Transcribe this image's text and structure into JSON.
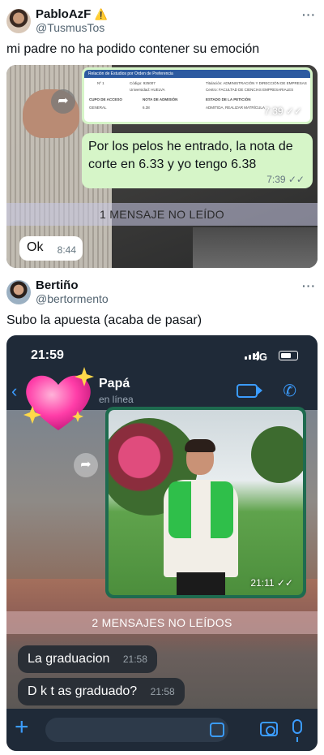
{
  "tweet1": {
    "display_name": "PabloAzF",
    "badge_emoji": "⚠️",
    "handle": "@TusmusTos",
    "text": "mi padre no ha podido contener su emoción"
  },
  "screenshot1": {
    "document": {
      "header": "Relación de Estudios por Orden de Preferencia",
      "order_label": "Nº 1",
      "code": "Código: 925007",
      "university": "Universidad: HUELVA",
      "degree": "Titulación: ADMINISTRACIÓN Y DIRECCIÓN DE EMPRESAS",
      "center": "Centro: FACULTAD DE CIENCIAS EMPRESARIALES",
      "access_quota_label": "CUPO DE ACCESO",
      "admission_grade_label": "NOTA DE ADMISIÓN",
      "request_state_label": "ESTADO DE LA PETICIÓN",
      "access_quota": "GENERAL",
      "admission_grade": "6.38",
      "request_state": "ADMITIDA, REALIZAR MATRÍCULA",
      "time": "7:39 ✓✓"
    },
    "message": {
      "text": "Por los pelos he entrado, la nota de corte en 6.33 y yo tengo 6.38",
      "time": "7:39 ✓✓"
    },
    "unread_banner": "1 MENSAJE NO LEÍDO",
    "reply": {
      "text": "Ok",
      "time": "8:44"
    }
  },
  "tweet2": {
    "display_name": "Bertiño",
    "handle": "@bertormento",
    "text": "Subo la apuesta (acaba de pasar)"
  },
  "screenshot2": {
    "status": {
      "time": "21:59",
      "network": "4G"
    },
    "chat": {
      "contact_name": "Papá",
      "contact_status": "en línea",
      "photo_time": "21:11 ✓✓",
      "unread_banner": "2 MENSAJES NO LEÍDOS",
      "messages": [
        {
          "text": "La graduacion",
          "time": "21:58"
        },
        {
          "text": "D k t as graduado?",
          "time": "21:58"
        }
      ]
    },
    "colors": {
      "accent": "#3b9cff",
      "outgoing_bubble": "#d6f5c8",
      "incoming_dark": "#2a2f36"
    }
  }
}
